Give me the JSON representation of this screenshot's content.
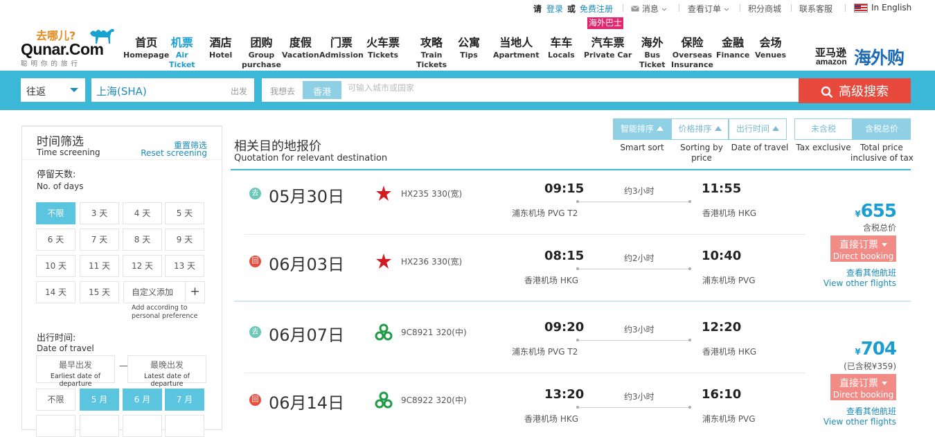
{
  "topbar": {
    "qing": "请",
    "login": "登录",
    "or": "或",
    "register": "免费注册",
    "messages": "消息",
    "orders": "查看订单",
    "points": "积分商城",
    "service": "联系客服",
    "language": "In English"
  },
  "logo": {
    "cn": "去哪儿?",
    "en": "Qunar.Com",
    "slogan": "聪明你的旅行"
  },
  "nav": [
    {
      "zh": "首页",
      "en": "Homepage"
    },
    {
      "zh": "机票",
      "en": "Air",
      "en2": "Ticket"
    },
    {
      "zh": "酒店",
      "en": "Hotel"
    },
    {
      "zh": "团购",
      "en": "Group",
      "en2": "purchase"
    },
    {
      "zh": "度假",
      "en": "Vacation"
    },
    {
      "zh": "门票",
      "en": "Admission"
    },
    {
      "zh": "火车票",
      "en": "Tickets"
    },
    {
      "zh": "攻略",
      "en": "Train",
      "en2": "Tickets"
    },
    {
      "zh": "公寓",
      "en": "Tips"
    },
    {
      "zh": "当地人",
      "en": "Apartment"
    },
    {
      "zh": "车车",
      "en": "Locals"
    },
    {
      "zh": "汽车票",
      "en": "Private Car"
    },
    {
      "zh": "海外",
      "en": "Bus",
      "en2": "Ticket"
    },
    {
      "zh": "保险",
      "en": "Overseas",
      "en2": "Insurance"
    },
    {
      "zh": "金融",
      "en": "Finance"
    },
    {
      "zh": "会场",
      "en": "Venues"
    }
  ],
  "badge": "海外巴士",
  "amazon": {
    "zh": "亚马逊",
    "en": "amazon",
    "text": "海外购"
  },
  "search": {
    "trip_type": "往返",
    "from_value": "上海(SHA)",
    "from_label": "出发",
    "to_label": "我想去",
    "to_tag": "香港",
    "to_placeholder": "可输入城市或国家",
    "button": "高级搜索"
  },
  "filter": {
    "title_zh": "时间筛选",
    "title_en": "Time screening",
    "reset_zh": "重置筛选",
    "reset_en": "Reset screening",
    "days_zh": "停留天数:",
    "days_en": "No. of days",
    "day_options": [
      "不限",
      "3 天",
      "4 天",
      "5 天",
      "6 天",
      "7 天",
      "8 天",
      "9 天",
      "10 天",
      "11 天",
      "12 天",
      "13 天",
      "14 天",
      "15 天"
    ],
    "custom_add": "自定义添加",
    "plus": "+",
    "hint1": "Add according to",
    "hint2": "personal preference",
    "date_zh": "出行时间:",
    "date_en": "Date of travel",
    "earliest_zh": "最早出发",
    "earliest_en": "Earliest date of departure",
    "latest_zh": "最晚出发",
    "latest_en": "Latest date of departure",
    "dash": "—",
    "month_options": [
      "不限",
      "5 月",
      "6 月",
      "7 月"
    ]
  },
  "results": {
    "title_zh": "相关目的地报价",
    "title_en": "Quotation for relevant destination",
    "sort": [
      {
        "zh": "智能排序",
        "en": "Smart sort"
      },
      {
        "zh": "价格排序",
        "en": "Sorting by",
        "en2": "price"
      },
      {
        "zh": "出行时间",
        "en": "Date of travel"
      }
    ],
    "tax": [
      {
        "zh": "未含税",
        "en": "Tax exclusive"
      },
      {
        "zh": "含税总价",
        "en": "Total price",
        "en2": "inclusive of tax"
      }
    ],
    "cards": [
      {
        "price_symbol": "¥",
        "price": "655",
        "price_note": "含税总价",
        "book_zh": "直接订票",
        "book_en": "Direct booking",
        "other_zh": "查看其他航班",
        "other_en": "View other flights",
        "trips": [
          {
            "dir": "去",
            "date": "05月30日",
            "flight": "HX235 330(宽)",
            "dep_time": "09:15",
            "duration": "约3小时",
            "arr_time": "11:55",
            "dep_airport": "浦东机场 PVG T2",
            "arr_airport": "香港机场 HKG"
          },
          {
            "dir": "回",
            "date": "06月03日",
            "flight": "HX236 330(宽)",
            "dep_time": "08:15",
            "duration": "约2小时",
            "arr_time": "10:40",
            "dep_airport": "香港机场 HKG",
            "arr_airport": "浦东机场 PVG"
          }
        ]
      },
      {
        "price_symbol": "¥",
        "price": "704",
        "price_note": "(已含税¥359)",
        "book_zh": "直接订票",
        "book_en": "Direct booking",
        "other_zh": "查看其他航班",
        "other_en": "View other flights",
        "trips": [
          {
            "dir": "去",
            "date": "06月07日",
            "flight": "9C8921 320(中)",
            "dep_time": "09:20",
            "duration": "约3小时",
            "arr_time": "12:20",
            "dep_airport": "浦东机场 PVG T2",
            "arr_airport": "香港机场 HKG"
          },
          {
            "dir": "回",
            "date": "06月14日",
            "flight": "9C8922 320(中)",
            "dep_time": "13:20",
            "duration": "约3小时",
            "arr_time": "16:10",
            "dep_airport": "香港机场 HKG",
            "arr_airport": "浦东机场 PVG"
          }
        ]
      }
    ]
  },
  "colors": {
    "accent": "#3bb7d7",
    "search_button": "#e74a3c",
    "price": "#1a9ed0",
    "book_button": "#f28b86",
    "hk_airlines": "#d21c24",
    "spring_airlines": "#1f9c45"
  }
}
